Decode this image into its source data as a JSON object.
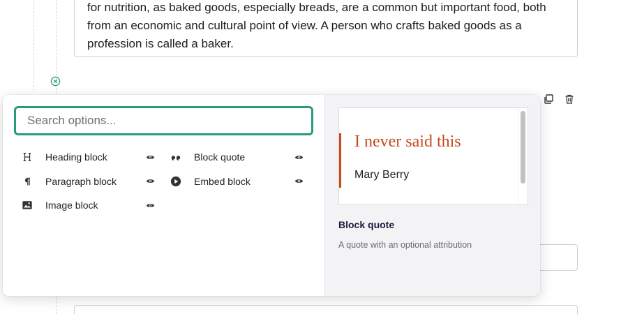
{
  "editor": {
    "paragraph_text": "for nutrition, as baked goods, especially breads, are a common but important food, both from an economic and cultural point of view. A person who crafts baked goods as a profession is called a baker."
  },
  "chooser": {
    "search": {
      "placeholder": "Search options..."
    },
    "options": [
      {
        "label": "Heading block",
        "icon": "heading-icon"
      },
      {
        "label": "Block quote",
        "icon": "quote-icon"
      },
      {
        "label": "Paragraph block",
        "icon": "pilcrow-icon"
      },
      {
        "label": "Embed block",
        "icon": "play-circle-icon"
      },
      {
        "label": "Image block",
        "icon": "image-icon"
      }
    ],
    "preview": {
      "quote_text": "I never said this",
      "attribution": "Mary Berry",
      "title": "Block quote",
      "description": "A quote with an optional attribution"
    }
  },
  "colors": {
    "accent": "#2a9a7f",
    "quote": "#c64a1c"
  }
}
